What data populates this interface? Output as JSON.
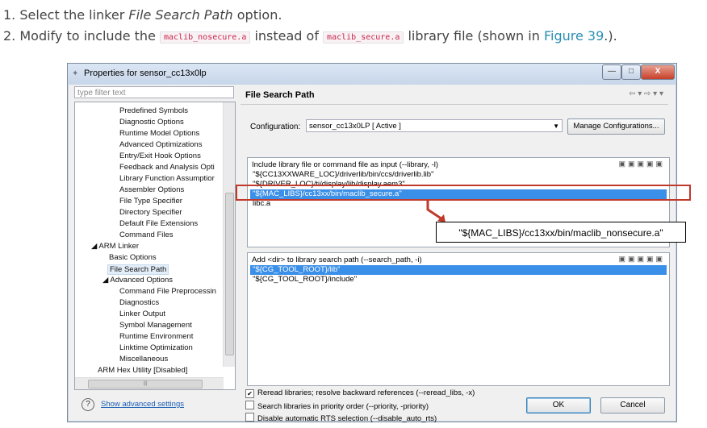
{
  "instructions": {
    "step1_prefix": "1. Select the linker ",
    "step1_option": "File Search Path",
    "step1_suffix": " option.",
    "step2_prefix": "2. Modify to include the ",
    "step2_code1": "maclib_nosecure.a",
    "step2_mid": " instead of ",
    "step2_code2": "maclib_secure.a",
    "step2_suffix1": " library file (shown in ",
    "step2_link": "Figure 39",
    "step2_suffix2": ".)."
  },
  "dialog": {
    "title": "Properties for sensor_cc13x0lp",
    "minimize_label": "—",
    "maximize_label": "□",
    "close_label": "X"
  },
  "left": {
    "filter_placeholder": "type filter text",
    "tree": [
      "Predefined Symbols",
      "Diagnostic Options",
      "Runtime Model Options",
      "Advanced Optimizations",
      "Entry/Exit Hook Options",
      "Feedback and Analysis Opti",
      "Library Function Assumptior",
      "Assembler Options",
      "File Type Specifier",
      "Directory Specifier",
      "Default File Extensions",
      "Command Files",
      "◢ ARM Linker",
      "Basic Options",
      "File Search Path",
      "◢ Advanced Options",
      "Command File Preprocessin",
      "Diagnostics",
      "Linker Output",
      "Symbol Management",
      "Runtime Environment",
      "Linktime Optimization",
      "Miscellaneous",
      "ARM Hex Utility  [Disabled]"
    ]
  },
  "panel": {
    "title": "File Search Path",
    "config_label": "Configuration:",
    "config_value": "sensor_cc13x0LP  [ Active ]",
    "manage_button": "Manage Configurations...",
    "include_header": "Include library file or command file as input (--library, -l)",
    "include_items": [
      "\"${CC13XXWARE_LOC}/driverlib/bin/ccs/driverlib.lib\"",
      "\"${DRIVER_LOC}/ti/display/lib/display.aem3\"",
      "\"${MAC_LIBS}/cc13xx/bin/maclib_secure.a\"",
      "libc.a"
    ],
    "search_header": "Add <dir> to library search path (--search_path, -i)",
    "search_items": [
      "\"${CG_TOOL_ROOT}/lib\"",
      "\"${CG_TOOL_ROOT}/include\""
    ],
    "callout": "\"${MAC_LIBS}/cc13xx/bin/maclib_nonsecure.a\"",
    "checks": [
      {
        "label": "Reread libraries; resolve backward references (--reread_libs, -x)",
        "checked": true
      },
      {
        "label": "Search libraries in priority order (--priority, -priority)",
        "checked": false
      },
      {
        "label": "Disable automatic RTS selection (--disable_auto_rts)",
        "checked": false
      }
    ]
  },
  "footer": {
    "help_icon": "?",
    "show_advanced": "Show advanced settings",
    "ok": "OK",
    "cancel": "Cancel"
  },
  "colors": {
    "selection": "#3a8fe8",
    "callout_border": "#c0392b"
  }
}
